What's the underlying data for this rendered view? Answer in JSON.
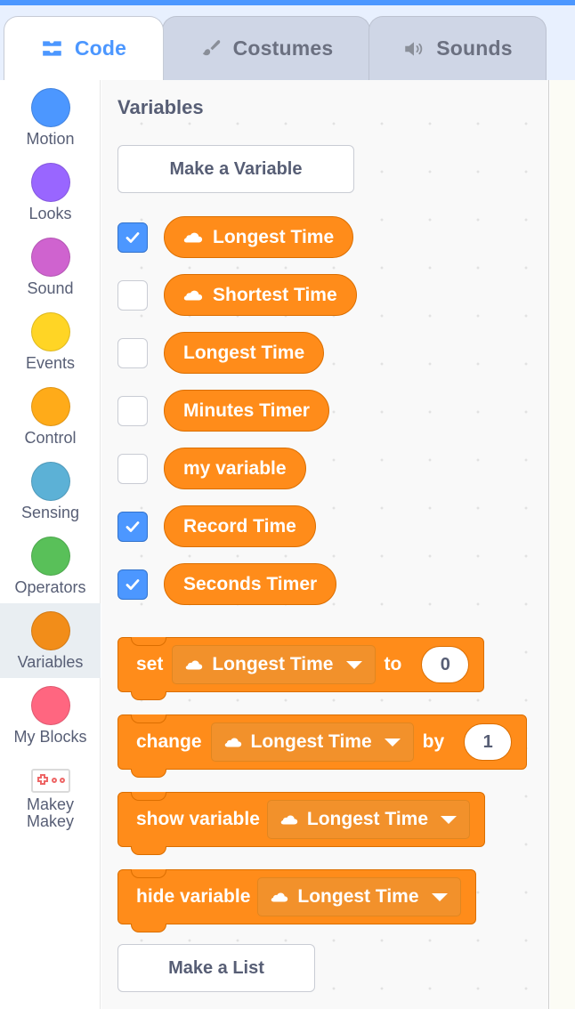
{
  "theme": {
    "accent_blue": "#4C97FF",
    "variables_orange": "#FF8C1A",
    "variables_orange_dark": "#DB6E00",
    "text_gray": "#575E75"
  },
  "tabs": [
    {
      "id": "code",
      "label": "Code",
      "icon": "code-blocks-icon",
      "active": true
    },
    {
      "id": "costumes",
      "label": "Costumes",
      "icon": "paintbrush-icon",
      "active": false
    },
    {
      "id": "sounds",
      "label": "Sounds",
      "icon": "speaker-icon",
      "active": false
    }
  ],
  "categories": [
    {
      "label": "Motion",
      "color": "#4C97FF",
      "icon": "motion-dot-icon",
      "selected": false
    },
    {
      "label": "Looks",
      "color": "#9966FF",
      "icon": "looks-dot-icon",
      "selected": false
    },
    {
      "label": "Sound",
      "color": "#CF63CF",
      "icon": "sound-dot-icon",
      "selected": false
    },
    {
      "label": "Events",
      "color": "#FFD525",
      "icon": "events-dot-icon",
      "selected": false
    },
    {
      "label": "Control",
      "color": "#FFAB19",
      "icon": "control-dot-icon",
      "selected": false
    },
    {
      "label": "Sensing",
      "color": "#5CB1D6",
      "icon": "sensing-dot-icon",
      "selected": false
    },
    {
      "label": "Operators",
      "color": "#59C059",
      "icon": "operators-dot-icon",
      "selected": false
    },
    {
      "label": "Variables",
      "color": "#F28D19",
      "icon": "variables-dot-icon",
      "selected": true
    },
    {
      "label": "My Blocks",
      "color": "#FF6680",
      "icon": "myblocks-dot-icon",
      "selected": false
    },
    {
      "label": "Makey\nMakey",
      "color": "#EE6666",
      "icon": "makey-makey-icon",
      "selected": false
    }
  ],
  "palette": {
    "title": "Variables",
    "make_variable_label": "Make a Variable",
    "make_list_label": "Make a List",
    "variables": [
      {
        "name": "Longest Time",
        "checked": true,
        "cloud": true
      },
      {
        "name": "Shortest Time",
        "checked": false,
        "cloud": true
      },
      {
        "name": "Longest Time",
        "checked": false,
        "cloud": false
      },
      {
        "name": "Minutes Timer",
        "checked": false,
        "cloud": false
      },
      {
        "name": "my variable",
        "checked": false,
        "cloud": false
      },
      {
        "name": "Record Time",
        "checked": true,
        "cloud": false
      },
      {
        "name": "Seconds Timer",
        "checked": true,
        "cloud": false
      }
    ],
    "blocks": [
      {
        "id": "set-variable-block",
        "prefix": "set",
        "dropdown": "Longest Time",
        "dropdown_cloud": true,
        "infix": "to",
        "value": "0"
      },
      {
        "id": "change-variable-block",
        "prefix": "change",
        "dropdown": "Longest Time",
        "dropdown_cloud": true,
        "infix": "by",
        "value": "1"
      },
      {
        "id": "show-variable-block",
        "prefix": "show variable",
        "dropdown": "Longest Time",
        "dropdown_cloud": true,
        "infix": "",
        "value": ""
      },
      {
        "id": "hide-variable-block",
        "prefix": "hide variable",
        "dropdown": "Longest Time",
        "dropdown_cloud": true,
        "infix": "",
        "value": ""
      }
    ]
  }
}
